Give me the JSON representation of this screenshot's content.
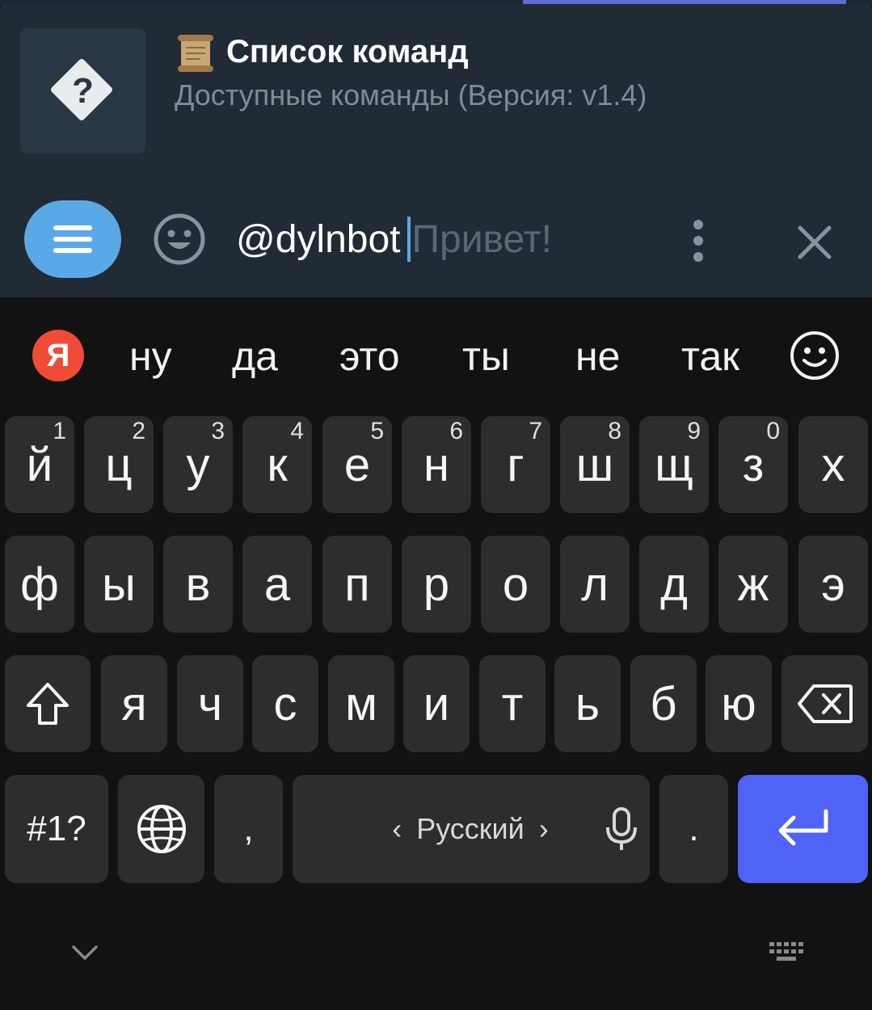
{
  "command_suggestion": {
    "title": "Список команд",
    "subtitle": "Доступные команды (Версия: v1.4)",
    "thumb_glyph": "?",
    "title_icon": "scroll-icon"
  },
  "input_bar": {
    "value": "@dylnbot",
    "placeholder": "Привет!"
  },
  "keyboard": {
    "brand_logo": "Я",
    "suggestions": [
      "ну",
      "да",
      "это",
      "ты",
      "не",
      "так"
    ],
    "row1": [
      {
        "label": "й",
        "num": "1"
      },
      {
        "label": "ц",
        "num": "2"
      },
      {
        "label": "у",
        "num": "3"
      },
      {
        "label": "к",
        "num": "4"
      },
      {
        "label": "е",
        "num": "5"
      },
      {
        "label": "н",
        "num": "6"
      },
      {
        "label": "г",
        "num": "7"
      },
      {
        "label": "ш",
        "num": "8"
      },
      {
        "label": "щ",
        "num": "9"
      },
      {
        "label": "з",
        "num": "0"
      },
      {
        "label": "х",
        "num": ""
      }
    ],
    "row2": [
      "ф",
      "ы",
      "в",
      "а",
      "п",
      "р",
      "о",
      "л",
      "д",
      "ж",
      "э"
    ],
    "row3": [
      "я",
      "ч",
      "с",
      "м",
      "и",
      "т",
      "ь",
      "б",
      "ю"
    ],
    "symbols_label": "#1?",
    "comma_label": ",",
    "space_label": "Русский",
    "space_left_arrow": "‹",
    "space_right_arrow": "›",
    "period_label": ".",
    "accent_color": "#4f63f5"
  }
}
